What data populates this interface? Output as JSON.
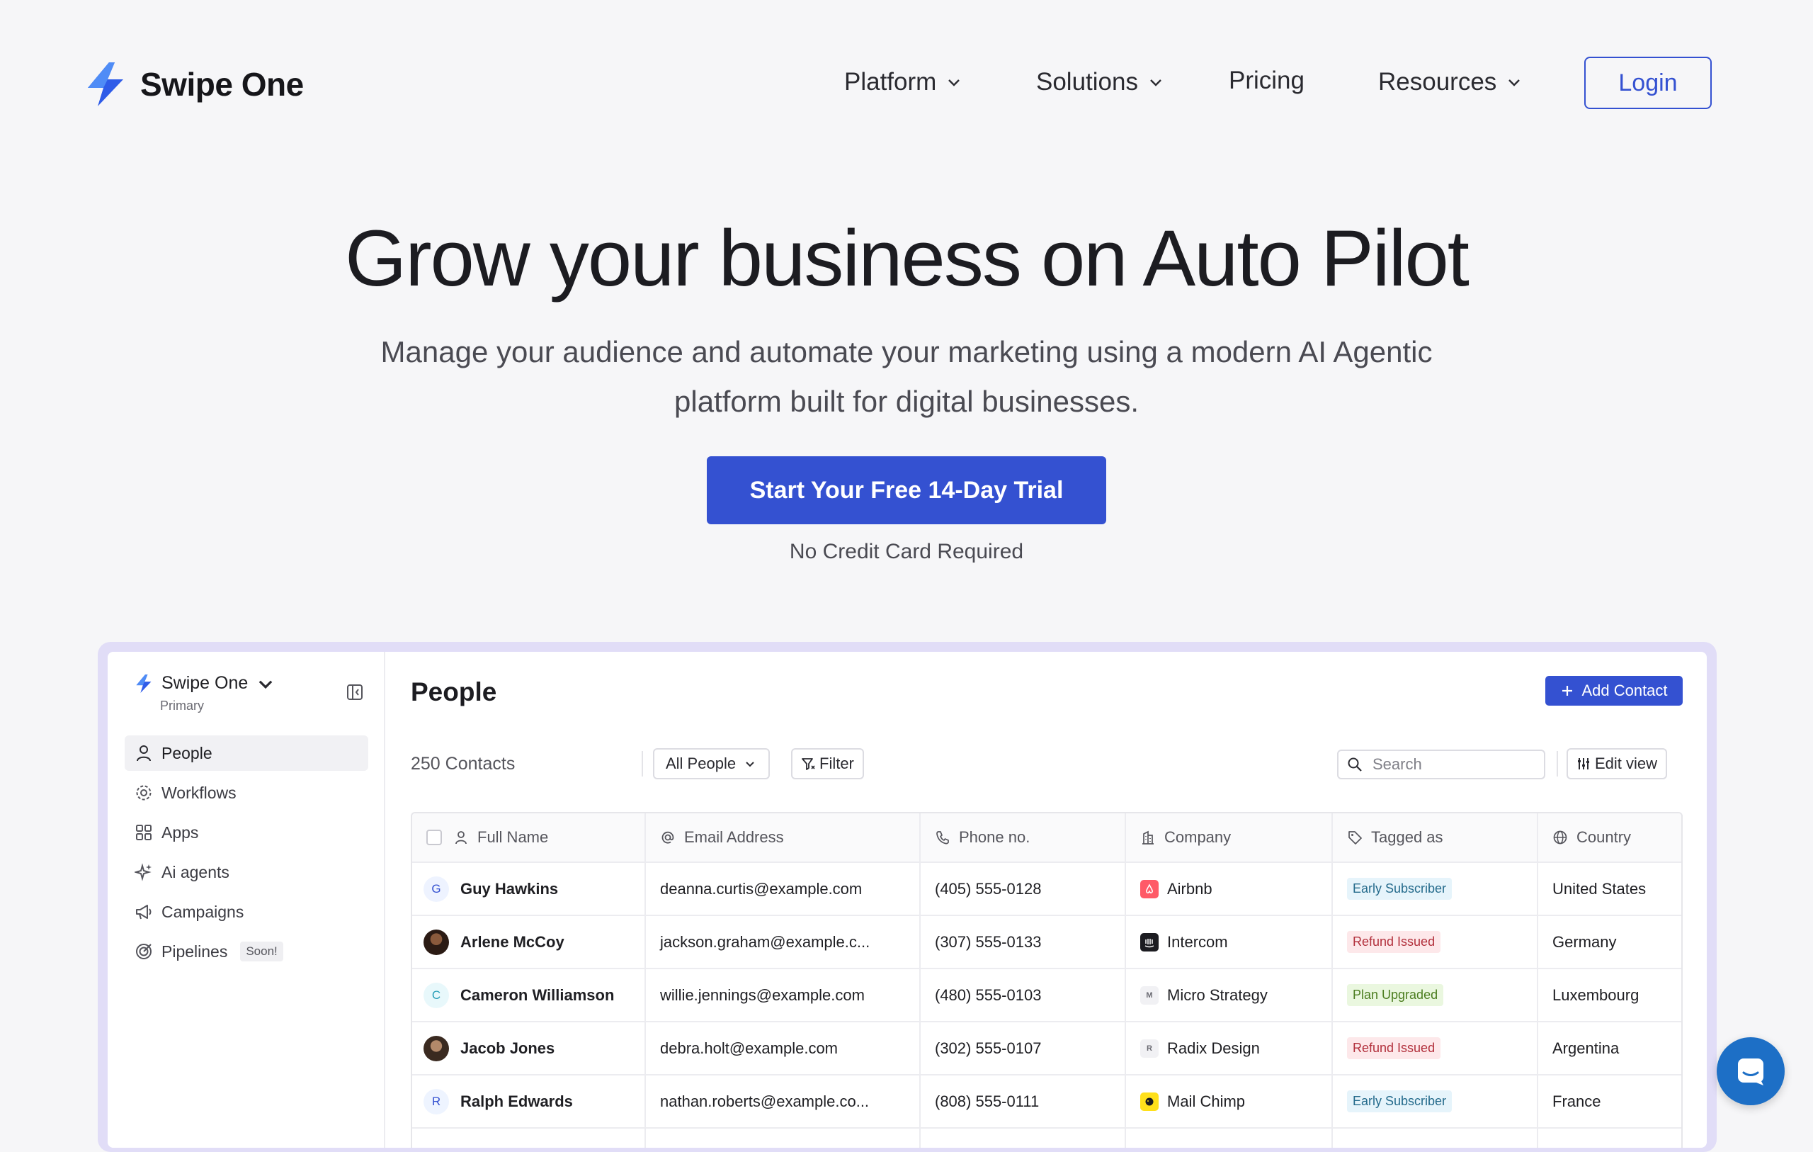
{
  "brand": {
    "name": "Swipe One",
    "accent": "#3451d1",
    "logo_icon": "lightning-bolt-icon"
  },
  "nav": {
    "items": [
      {
        "label": "Platform",
        "has_dropdown": true
      },
      {
        "label": "Solutions",
        "has_dropdown": true
      },
      {
        "label": "Pricing",
        "has_dropdown": false
      },
      {
        "label": "Resources",
        "has_dropdown": true
      }
    ],
    "login_label": "Login"
  },
  "hero": {
    "title": "Grow your business on Auto Pilot",
    "subtitle": "Manage your audience and automate your marketing using a modern AI Agentic platform built for digital businesses.",
    "cta_label": "Start Your Free 14-Day Trial",
    "cta_note": "No Credit Card Required"
  },
  "app": {
    "workspace": {
      "name": "Swipe One",
      "subtitle": "Primary"
    },
    "sidebar": [
      {
        "label": "People",
        "icon": "person-icon",
        "active": true
      },
      {
        "label": "Workflows",
        "icon": "gear-icon",
        "active": false
      },
      {
        "label": "Apps",
        "icon": "apps-grid-icon",
        "active": false
      },
      {
        "label": "Ai agents",
        "icon": "sparkle-icon",
        "active": false
      },
      {
        "label": "Campaigns",
        "icon": "megaphone-icon",
        "active": false
      },
      {
        "label": "Pipelines",
        "icon": "target-icon",
        "active": false,
        "badge": "Soon!"
      }
    ],
    "page_title": "People",
    "add_contact_label": "Add Contact",
    "toolbar": {
      "count_label": "250 Contacts",
      "view_label": "All People",
      "filter_label": "Filter",
      "search_placeholder": "Search",
      "edit_view_label": "Edit view"
    },
    "columns": [
      "Full Name",
      "Email Address",
      "Phone no.",
      "Company",
      "Tagged as",
      "Country"
    ],
    "rows": [
      {
        "avatar": "G",
        "avatar_type": "letter",
        "name": "Guy Hawkins",
        "email": "deanna.curtis@example.com",
        "phone": "(405) 555-0128",
        "company": "Airbnb",
        "company_logo": "airbnb-logo-icon",
        "tag": "Early Subscriber",
        "tag_kind": "early",
        "country": "United States"
      },
      {
        "avatar": "",
        "avatar_type": "photo",
        "name": "Arlene McCoy",
        "email": "jackson.graham@example.c...",
        "phone": "(307) 555-0133",
        "company": "Intercom",
        "company_logo": "intercom-logo-icon",
        "tag": "Refund Issued",
        "tag_kind": "refund",
        "country": "Germany"
      },
      {
        "avatar": "C",
        "avatar_type": "letter-c",
        "name": "Cameron Williamson",
        "email": "willie.jennings@example.com",
        "phone": "(480) 555-0103",
        "company": "Micro Strategy",
        "company_logo": "microstrategy-logo-icon",
        "tag": "Plan Upgraded",
        "tag_kind": "plan",
        "country": "Luxembourg"
      },
      {
        "avatar": "",
        "avatar_type": "photo2",
        "name": "Jacob Jones",
        "email": "debra.holt@example.com",
        "phone": "(302) 555-0107",
        "company": "Radix Design",
        "company_logo": "radix-logo-icon",
        "tag": "Refund Issued",
        "tag_kind": "refund",
        "country": "Argentina"
      },
      {
        "avatar": "R",
        "avatar_type": "letter-r",
        "name": "Ralph Edwards",
        "email": "nathan.roberts@example.co...",
        "phone": "(808) 555-0111",
        "company": "Mail Chimp",
        "company_logo": "mailchimp-logo-icon",
        "tag": "Early Subscriber",
        "tag_kind": "early",
        "country": "France"
      }
    ]
  },
  "chat_widget": {
    "icon": "chat-bubble-icon",
    "color": "#1d6fc6"
  }
}
